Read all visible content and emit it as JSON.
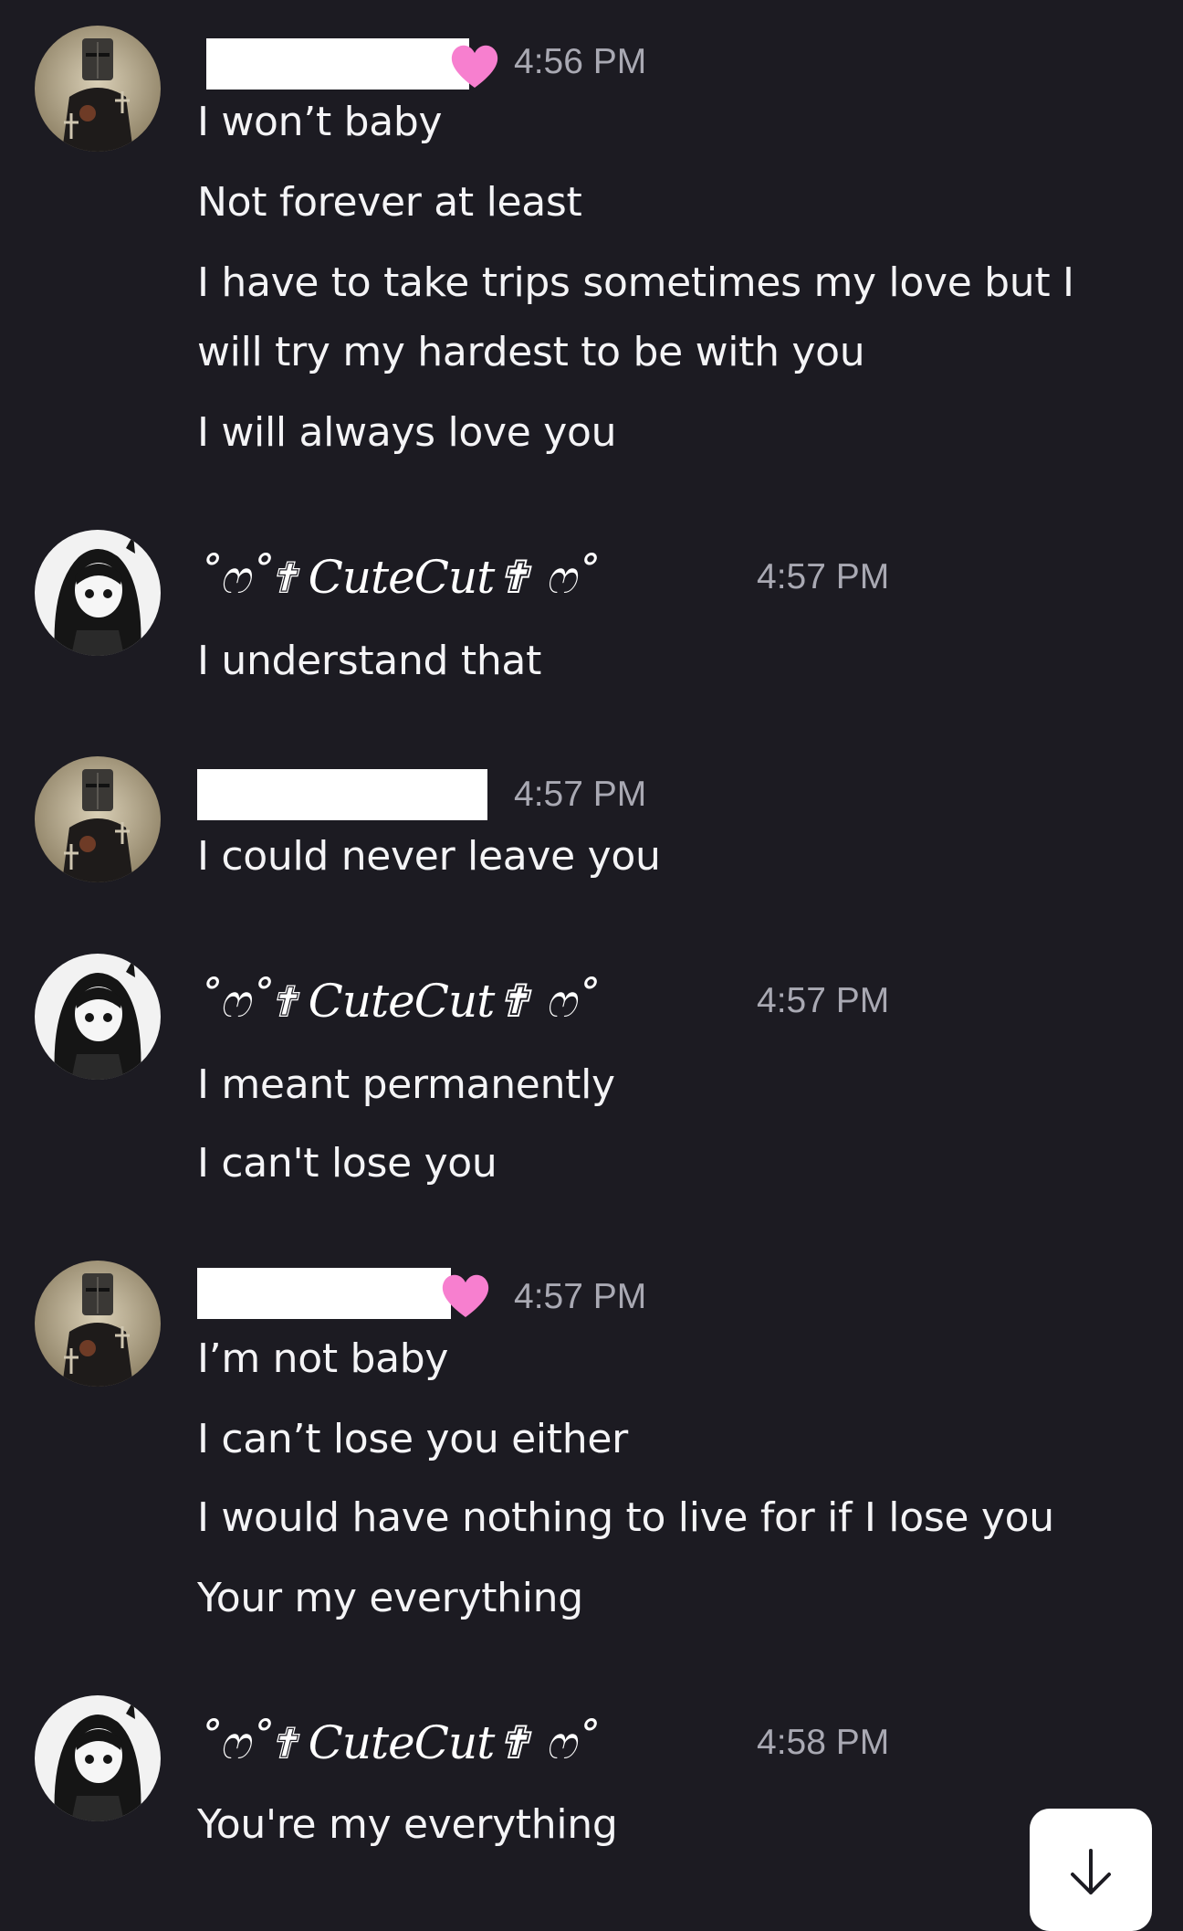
{
  "messages": [
    {
      "sender": "redacted",
      "time": "4:56 PM",
      "lines": [
        "I won’t baby",
        "Not forever at least",
        "I have to take trips sometimes my love but I",
        "will try my hardest to be with you",
        "I will always love you"
      ]
    },
    {
      "sender": "˚ෆ˚✟ CuteCut✟ ෆ˚",
      "time": "4:57 PM",
      "lines": [
        "I understand that"
      ]
    },
    {
      "sender": "redacted",
      "time": "4:57 PM",
      "lines": [
        "I could never leave you"
      ]
    },
    {
      "sender": "˚ෆ˚✟ CuteCut✟ ෆ˚",
      "time": "4:57 PM",
      "lines": [
        "I meant permanently",
        "I can't lose you"
      ]
    },
    {
      "sender": "redacted",
      "time": "4:57 PM",
      "lines": [
        "I’m not baby",
        "I can’t lose you either",
        "I would have nothing to live for if I lose you",
        "Your my everything"
      ]
    },
    {
      "sender": "˚ෆ˚✟ CuteCut✟ ෆ˚",
      "time": "4:58 PM",
      "lines": [
        "You're my everything"
      ]
    }
  ],
  "icons": {
    "scroll": "arrow-down-icon",
    "name_decoration": "heart-icon"
  },
  "colors": {
    "background": "#1c1b22",
    "text": "#f4f4f6",
    "timestamp": "#a9a9b3",
    "heart": "#f77fcf"
  }
}
